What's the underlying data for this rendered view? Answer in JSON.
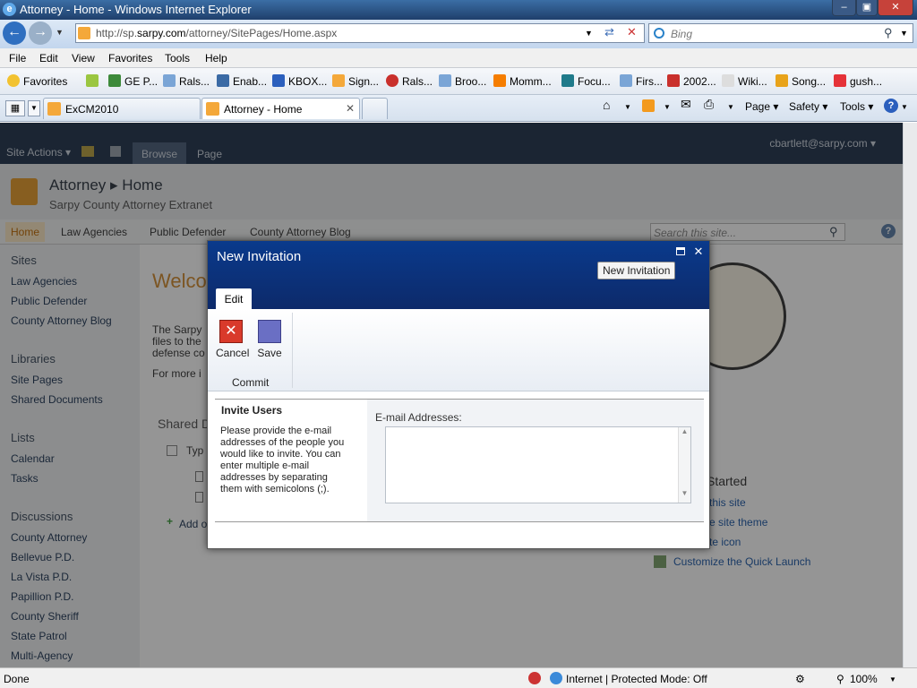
{
  "window": {
    "title": "Attorney - Home - Windows Internet Explorer"
  },
  "address": {
    "url_pre": "http://sp.",
    "url_host": "sarpy.com",
    "url_post": "/attorney/SitePages/Home.aspx"
  },
  "search": {
    "placeholder": "Bing"
  },
  "menu": [
    "File",
    "Edit",
    "View",
    "Favorites",
    "Tools",
    "Help"
  ],
  "favorites": {
    "label": "Favorites",
    "items": [
      "GE P...",
      "Rals...",
      "Enab...",
      "KBOX...",
      "Sign...",
      "Rals...",
      "Broo...",
      "Momm...",
      "Focu...",
      "Firs...",
      "2002...",
      "Wiki...",
      "Song...",
      "gush..."
    ]
  },
  "tabs": [
    "ExCM2010",
    "Attorney - Home"
  ],
  "commandbar": {
    "page": "Page",
    "safety": "Safety",
    "tools": "Tools"
  },
  "sp": {
    "site_actions": "Site Actions",
    "ribbon_tabs": [
      "Browse",
      "Page"
    ],
    "user": "cbartlett@sarpy.com",
    "crumb_site": "Attorney",
    "crumb_page": "Home",
    "subtitle": "Sarpy County Attorney Extranet",
    "topnav": [
      "Home",
      "Law Agencies",
      "Public Defender",
      "County Attorney Blog"
    ],
    "search_placeholder": "Search this site...",
    "quicklaunch": {
      "sites_header": "Sites",
      "sites": [
        "Law Agencies",
        "Public Defender",
        "County Attorney Blog"
      ],
      "libraries_header": "Libraries",
      "libraries": [
        "Site Pages",
        "Shared Documents"
      ],
      "lists_header": "Lists",
      "lists": [
        "Calendar",
        "Tasks"
      ],
      "discussions_header": "Discussions",
      "discussions": [
        "County Attorney",
        "Bellevue P.D.",
        "La Vista P.D.",
        "Papillion P.D.",
        "County Sheriff",
        "State Patrol",
        "Multi-Agency"
      ]
    },
    "main": {
      "welcome": "Welco",
      "p1": "The Sarpy",
      "p2": "files to the",
      "p3": "defense co",
      "p4": "For more i",
      "shared": "Shared D",
      "typ": "Typ",
      "add": "Add o",
      "started": "Started",
      "gs1": "this site",
      "gs2": "e site theme",
      "gs3": "te icon",
      "gs4": "Customize the Quick Launch"
    }
  },
  "dialog": {
    "title": "New Invitation",
    "tab": "Edit",
    "tooltip": "New Invitation",
    "cancel": "Cancel",
    "save": "Save",
    "group": "Commit",
    "invite_header": "Invite Users",
    "invite_desc": "Please provide the e-mail addresses of the people you would like to invite. You can enter multiple e-mail addresses by separating them with semicolons (;).",
    "email_label": "E-mail Addresses:"
  },
  "status": {
    "left": "Done",
    "zone": "Internet | Protected Mode: Off",
    "zoom": "100%"
  }
}
